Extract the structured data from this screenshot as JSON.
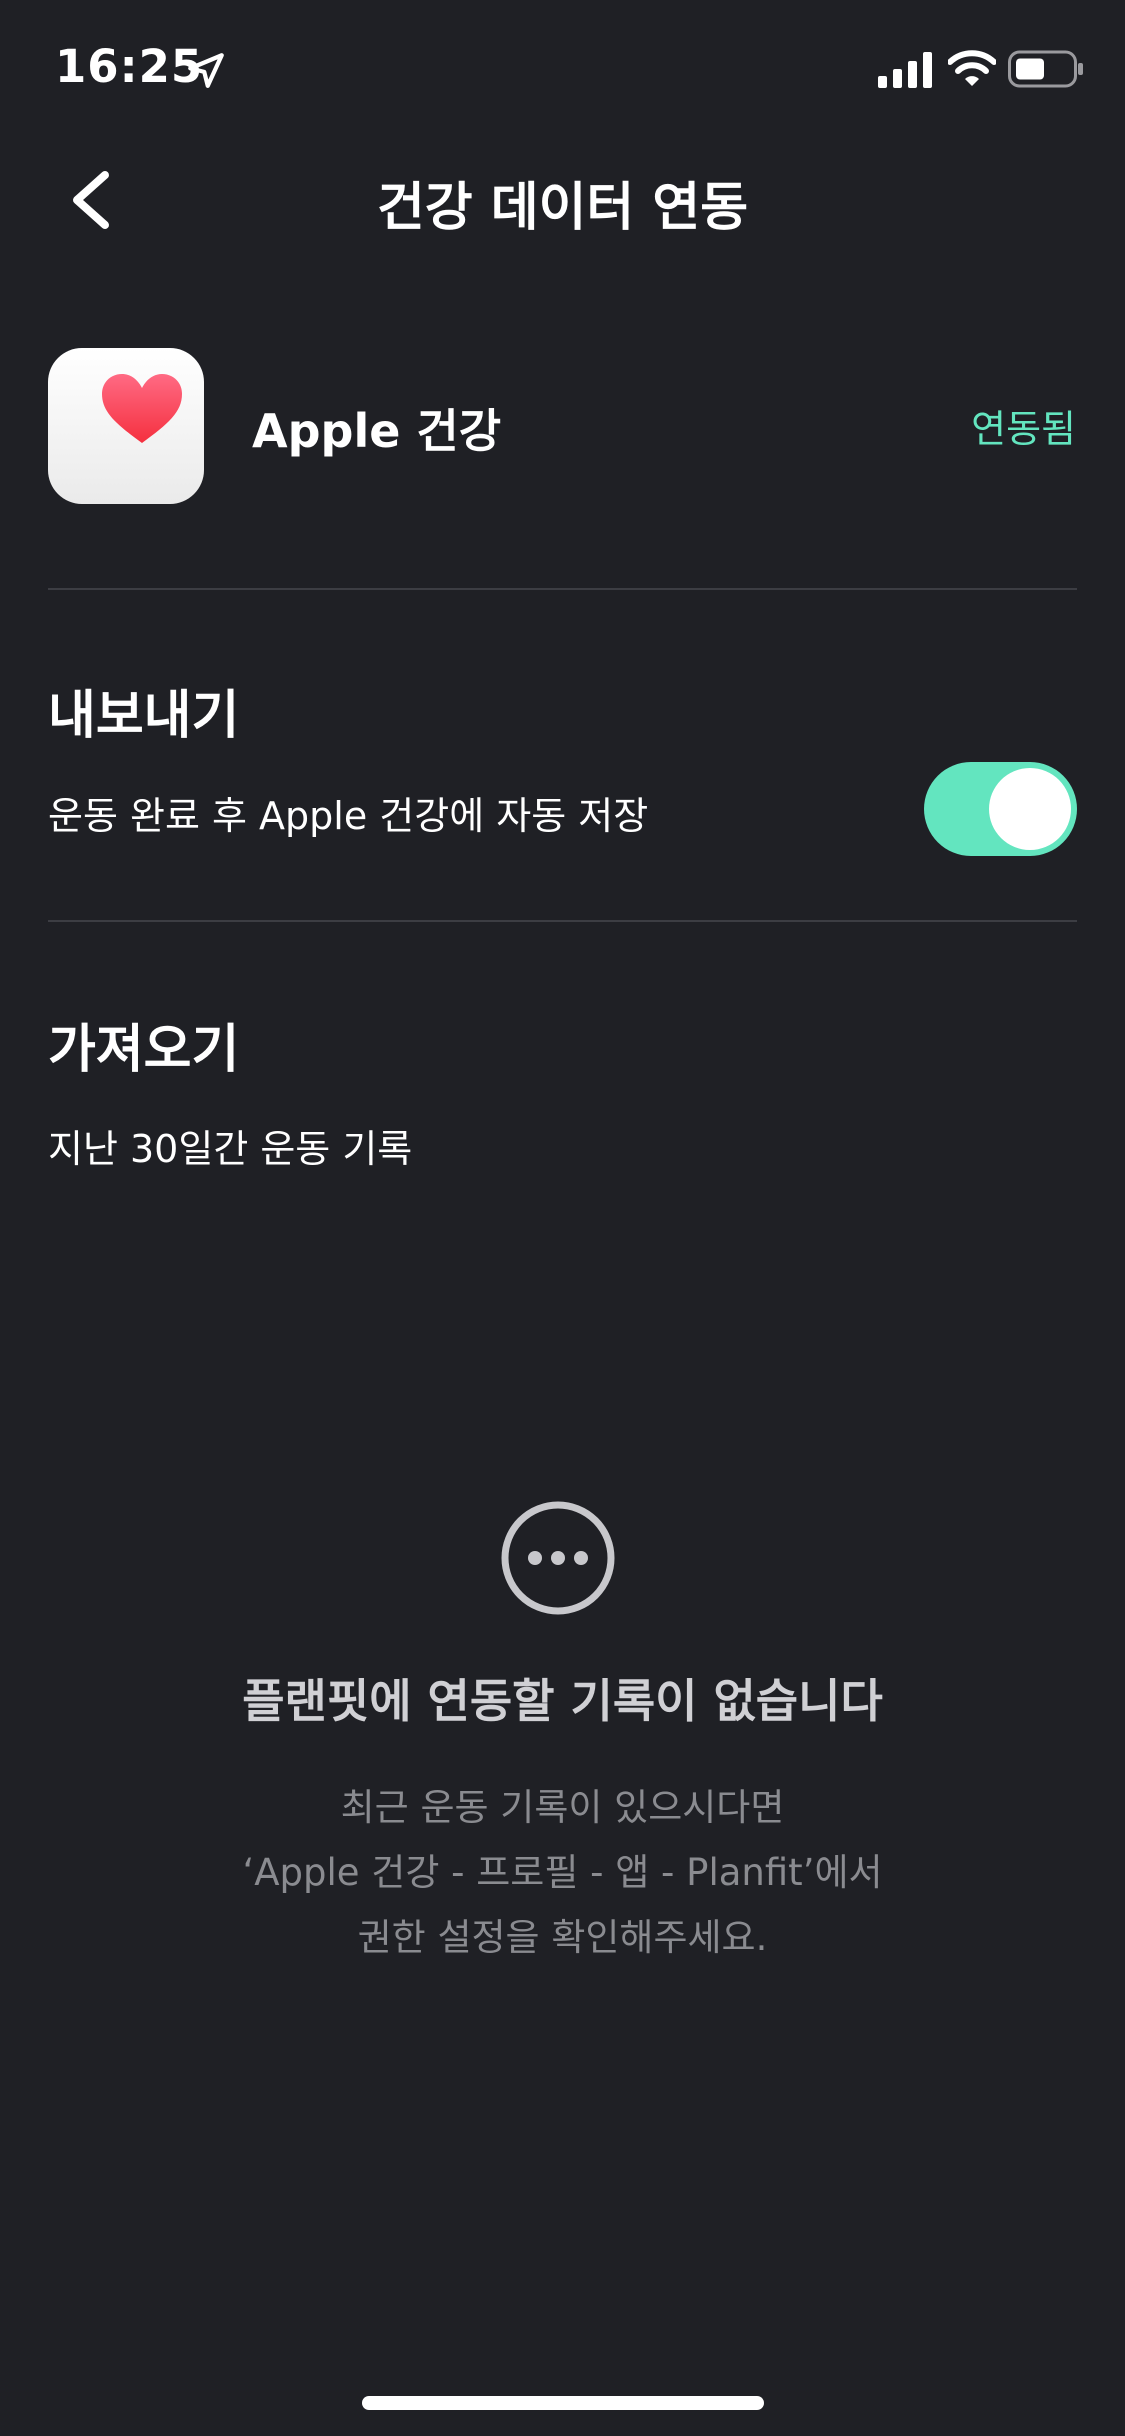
{
  "status_bar": {
    "time": "16:25"
  },
  "header": {
    "title": "건강 데이터 연동"
  },
  "integration": {
    "app_name": "Apple 건강",
    "status": "연동됨"
  },
  "export_section": {
    "title": "내보내기",
    "description": "운동 완료 후 Apple 건강에 자동 저장",
    "toggle_on": true
  },
  "import_section": {
    "title": "가져오기",
    "description": "지난 30일간 운동 기록"
  },
  "empty_state": {
    "title": "플랜핏에 연동할 기록이 없습니다",
    "line1": "최근 운동 기록이 있으시다면",
    "line2": "‘Apple 건강 - 프로필 - 앱 - Planfit’에서",
    "line3": "권한 설정을 확인해주세요."
  },
  "colors": {
    "background": "#1f2025",
    "accent": "#63e5bf",
    "divider": "#3c3d43",
    "secondary_text": "#8a8b90"
  }
}
